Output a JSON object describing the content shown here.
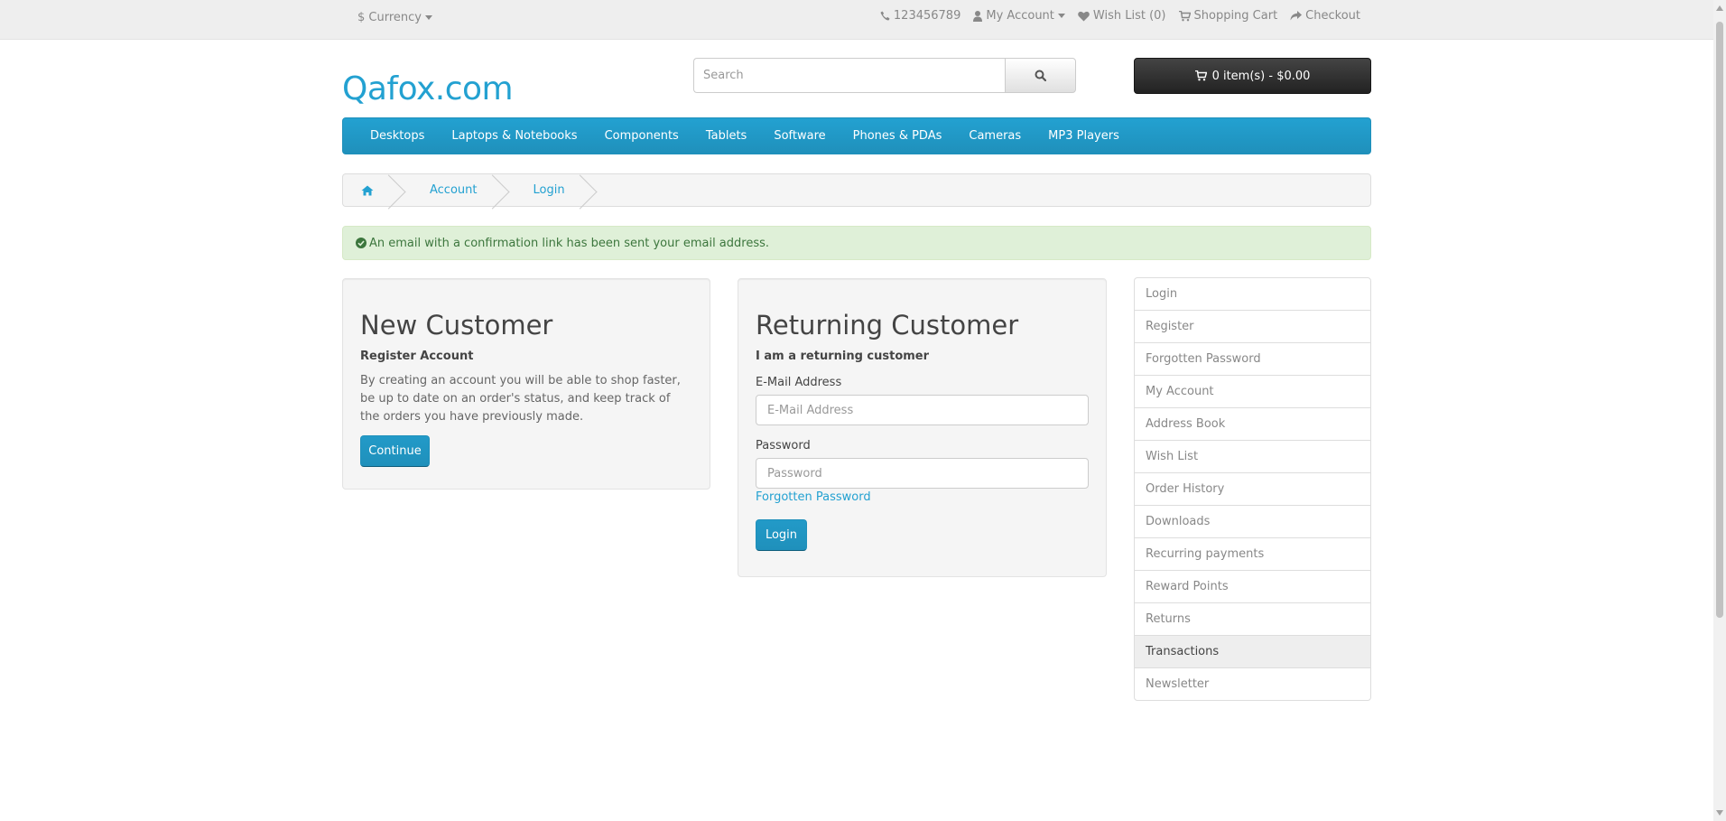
{
  "top_bar": {
    "currency_symbol": "$",
    "currency_label": "Currency",
    "phone": "123456789",
    "my_account": "My Account",
    "wish_list": "Wish List (0)",
    "shopping_cart": "Shopping Cart",
    "checkout": "Checkout"
  },
  "header": {
    "logo": "Qafox.com",
    "search_placeholder": "Search",
    "cart_label": "0 item(s) - $0.00"
  },
  "menu": {
    "items": [
      "Desktops",
      "Laptops & Notebooks",
      "Components",
      "Tablets",
      "Software",
      "Phones & PDAs",
      "Cameras",
      "MP3 Players"
    ]
  },
  "breadcrumb": {
    "items": [
      "Account",
      "Login"
    ]
  },
  "alert": {
    "message": "An email with a confirmation link has been sent your email address."
  },
  "new_customer": {
    "title": "New Customer",
    "subtitle": "Register Account",
    "description": "By creating an account you will be able to shop faster, be up to date on an order's status, and keep track of the orders you have previously made.",
    "button": "Continue"
  },
  "returning_customer": {
    "title": "Returning Customer",
    "subtitle": "I am a returning customer",
    "email_label": "E-Mail Address",
    "email_placeholder": "E-Mail Address",
    "password_label": "Password",
    "password_placeholder": "Password",
    "forgotten_link": "Forgotten Password",
    "button": "Login"
  },
  "sidebar": {
    "items": [
      "Login",
      "Register",
      "Forgotten Password",
      "My Account",
      "Address Book",
      "Wish List",
      "Order History",
      "Downloads",
      "Recurring payments",
      "Reward Points",
      "Returns",
      "Transactions",
      "Newsletter"
    ],
    "active_item": "Transactions"
  },
  "colors": {
    "brand": "#23a1d1",
    "menu_bg": "#229ac8",
    "alert_bg": "#dff0d8",
    "alert_text": "#3c763d",
    "cart_bg": "#363636"
  }
}
